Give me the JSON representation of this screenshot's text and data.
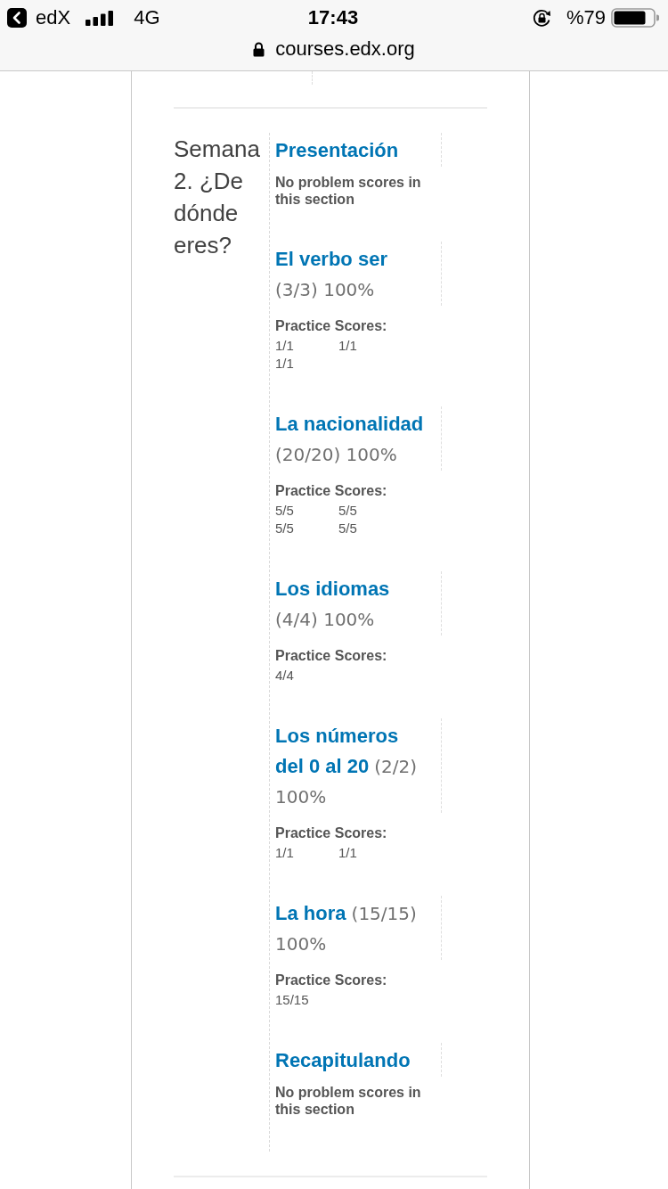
{
  "status_bar": {
    "back_label": "edX",
    "network": "4G",
    "time": "17:43",
    "battery": "%79"
  },
  "address_bar": {
    "url": "courses.edx.org"
  },
  "chapter": {
    "title": "Semana 2. ¿De dónde eres?",
    "subsections": [
      {
        "kind": "empty",
        "title": "Presentación",
        "message": "No problem scores in this section"
      },
      {
        "kind": "scored",
        "title": "El verbo ser",
        "score": "(3/3) 100%",
        "practice_label": "Practice Scores:",
        "practice_scores": [
          "1/1",
          "1/1",
          "1/1"
        ]
      },
      {
        "kind": "scored",
        "title": "La nacionalidad",
        "score": "(20/20) 100%",
        "practice_label": "Practice Scores:",
        "practice_scores": [
          "5/5",
          "5/5",
          "5/5",
          "5/5"
        ]
      },
      {
        "kind": "scored",
        "title": "Los idiomas",
        "score": "(4/4) 100%",
        "practice_label": "Practice Scores:",
        "practice_scores": [
          "4/4"
        ]
      },
      {
        "kind": "scored",
        "title": "Los números del 0 al 20",
        "score": "(2/2) 100%",
        "practice_label": "Practice Scores:",
        "practice_scores": [
          "1/1",
          "1/1"
        ]
      },
      {
        "kind": "scored",
        "title": "La hora",
        "score": "(15/15) 100%",
        "practice_label": "Practice Scores:",
        "practice_scores": [
          "15/15"
        ]
      },
      {
        "kind": "empty",
        "title": "Recapitulando",
        "message": "No problem scores in this section"
      }
    ]
  }
}
